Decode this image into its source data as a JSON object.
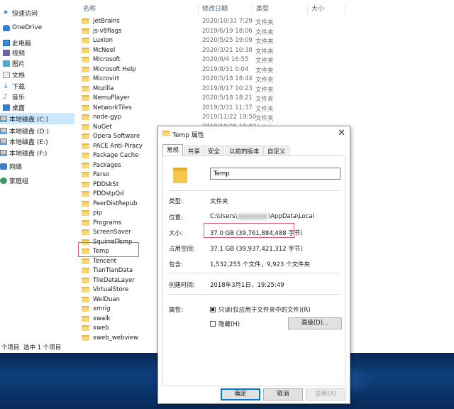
{
  "nav": {
    "items": [
      {
        "label": "快速访问",
        "icon": "star-icon"
      },
      {
        "label": "OneDrive",
        "icon": "cloud-icon"
      },
      {
        "label": "此电脑",
        "icon": "pc-icon"
      },
      {
        "label": "视频",
        "icon": "video-icon"
      },
      {
        "label": "图片",
        "icon": "picture-icon"
      },
      {
        "label": "文档",
        "icon": "document-icon"
      },
      {
        "label": "下载",
        "icon": "download-icon"
      },
      {
        "label": "音乐",
        "icon": "music-icon"
      },
      {
        "label": "桌面",
        "icon": "desktop-icon"
      },
      {
        "label": "本地磁盘 (C:)",
        "icon": "drive-icon"
      },
      {
        "label": "本地磁盘 (D:)",
        "icon": "drive-icon"
      },
      {
        "label": "本地磁盘 (E:)",
        "icon": "drive-icon"
      },
      {
        "label": "本地磁盘 (F:)",
        "icon": "drive-icon"
      },
      {
        "label": "网络",
        "icon": "network-icon"
      },
      {
        "label": "家庭组",
        "icon": "homegroup-icon"
      }
    ]
  },
  "columns": {
    "name": "名称",
    "date": "修改日期",
    "type": "类型",
    "size": "大小"
  },
  "files": [
    {
      "name": "JetBrains",
      "date": "2020/10/31 7:29",
      "type": "文件夹"
    },
    {
      "name": "js-v8flags",
      "date": "2019/6/19 18:06",
      "type": "文件夹"
    },
    {
      "name": "Luxion",
      "date": "2020/5/25 19:09",
      "type": "文件夹"
    },
    {
      "name": "McNeel",
      "date": "2020/3/21 10:38",
      "type": "文件夹"
    },
    {
      "name": "Microsoft",
      "date": "2020/6/4 16:55",
      "type": "文件夹"
    },
    {
      "name": "Microsoft Help",
      "date": "2019/8/31 0:04",
      "type": "文件夹"
    },
    {
      "name": "Microvirt",
      "date": "2020/5/18 18:44",
      "type": "文件夹"
    },
    {
      "name": "Mozilla",
      "date": "2019/8/17 10:23",
      "type": "文件夹"
    },
    {
      "name": "NemuPlayer",
      "date": "2020/5/18 18:21",
      "type": "文件夹"
    },
    {
      "name": "NetworkTiles",
      "date": "2019/3/31 11:37",
      "type": "文件夹"
    },
    {
      "name": "node-gyp",
      "date": "2019/11/22 19:50",
      "type": "文件夹"
    },
    {
      "name": "NuGet",
      "date": "2019/10/25 10:03",
      "type": "文件夹"
    },
    {
      "name": "Opera Software",
      "date": "",
      "type": ""
    },
    {
      "name": "PACE Anti-Piracy",
      "date": "",
      "type": ""
    },
    {
      "name": "Package Cache",
      "date": "",
      "type": ""
    },
    {
      "name": "Packages",
      "date": "",
      "type": ""
    },
    {
      "name": "Parso",
      "date": "",
      "type": ""
    },
    {
      "name": "PDDskSt",
      "date": "",
      "type": ""
    },
    {
      "name": "PDDstpQd",
      "date": "",
      "type": ""
    },
    {
      "name": "PeerDistRepub",
      "date": "",
      "type": ""
    },
    {
      "name": "pip",
      "date": "",
      "type": ""
    },
    {
      "name": "Programs",
      "date": "",
      "type": ""
    },
    {
      "name": "ScreenSaver",
      "date": "",
      "type": ""
    },
    {
      "name": "SquirrelTemp",
      "date": "",
      "type": ""
    },
    {
      "name": "Temp",
      "date": "",
      "type": ""
    },
    {
      "name": "Tencent",
      "date": "",
      "type": ""
    },
    {
      "name": "TianTianData",
      "date": "",
      "type": ""
    },
    {
      "name": "TileDataLayer",
      "date": "",
      "type": ""
    },
    {
      "name": "VirtualStore",
      "date": "",
      "type": ""
    },
    {
      "name": "WeiDuan",
      "date": "",
      "type": ""
    },
    {
      "name": "xmrig",
      "date": "",
      "type": ""
    },
    {
      "name": "xwalk",
      "date": "",
      "type": ""
    },
    {
      "name": "xweb",
      "date": "",
      "type": ""
    },
    {
      "name": "xweb_webview",
      "date": "",
      "type": ""
    }
  ],
  "status": {
    "count": "个项目",
    "selected": "选中 1 个项目"
  },
  "dialog": {
    "title": "Temp 属性",
    "close": "✕",
    "tabs": [
      "常规",
      "共享",
      "安全",
      "以前的版本",
      "自定义"
    ],
    "name_value": "Temp",
    "type_label": "类型:",
    "type_value": "文件夹",
    "location_label": "位置:",
    "location_prefix": "C:\\Users\\",
    "location_suffix": "\\AppData\\Local",
    "size_label": "大小:",
    "size_value": "37.0 GB (39,761,884,488 字节)",
    "disk_size_label": "占用空间:",
    "disk_size_value": "37.1 GB (39,937,421,312 字节)",
    "contains_label": "包含:",
    "contains_value": "1,532,255 个文件，9,923 个文件夹",
    "created_label": "创建时间:",
    "created_value": "2018年3月1日，19:25:49",
    "attributes_label": "属性:",
    "readonly_label": "只读(仅应用于文件夹中的文件)(R)",
    "readonly_checked": true,
    "hidden_label": "隐藏(H)",
    "hidden_checked": false,
    "advanced_label": "高级(D)...",
    "ok_label": "确定",
    "cancel_label": "取消",
    "apply_label": "应用(A)"
  },
  "colors": {
    "selection": "#cce8ff",
    "highlight_box": "#e05a7a",
    "default_button_border": "#0078d7"
  }
}
